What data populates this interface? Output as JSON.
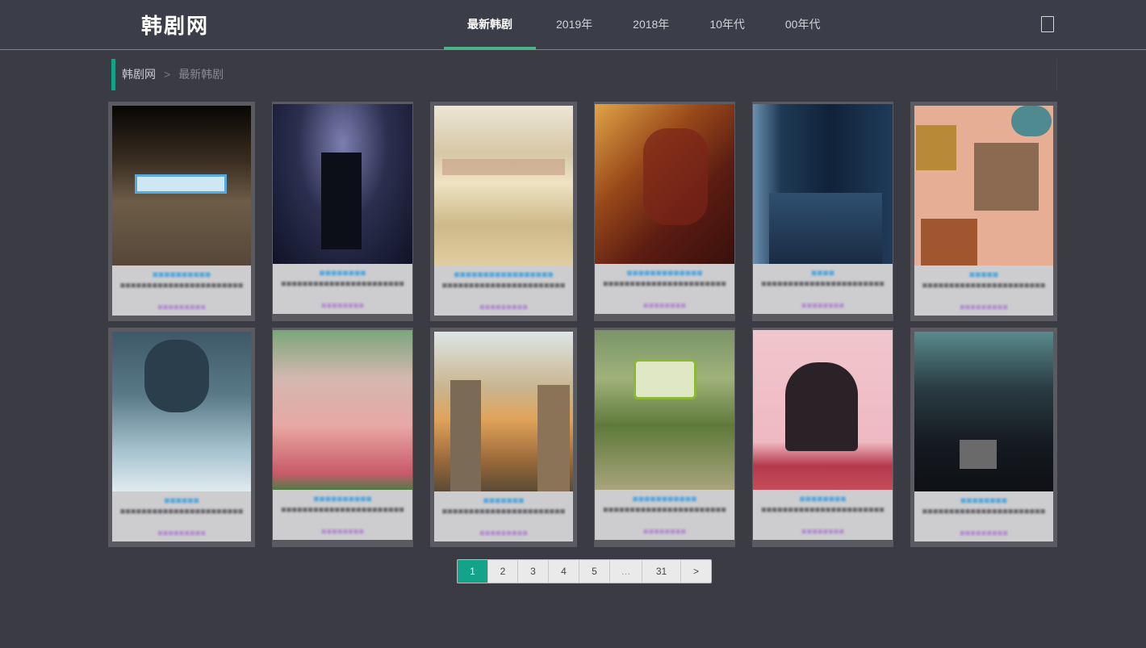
{
  "header": {
    "logo": "韩剧网",
    "nav": [
      {
        "label": "最新韩剧",
        "active": true
      },
      {
        "label": "2019年",
        "active": false
      },
      {
        "label": "2018年",
        "active": false
      },
      {
        "label": "10年代",
        "active": false
      },
      {
        "label": "00年代",
        "active": false
      }
    ],
    "icon": "bookmark-icon"
  },
  "breadcrumb": {
    "home": "韩剧网",
    "separator": ">",
    "current": "最新韩剧"
  },
  "colors": {
    "accent": "#13a38a",
    "nav_underline": "#4db384",
    "title_link": "#57a8de",
    "meta": "#b58fd0"
  },
  "cards": [
    {
      "title": "",
      "desc": "",
      "meta": ""
    },
    {
      "title": "",
      "desc": "",
      "meta": ""
    },
    {
      "title": "",
      "desc": "",
      "meta": ""
    },
    {
      "title": "",
      "desc": "",
      "meta": ""
    },
    {
      "title": "",
      "desc": "",
      "meta": ""
    },
    {
      "title": "",
      "desc": "",
      "meta": ""
    },
    {
      "title": "",
      "desc": "",
      "meta": ""
    },
    {
      "title": "",
      "desc": "",
      "meta": ""
    },
    {
      "title": "",
      "desc": "",
      "meta": ""
    },
    {
      "title": "",
      "desc": "",
      "meta": ""
    },
    {
      "title": "",
      "desc": "",
      "meta": ""
    },
    {
      "title": "",
      "desc": "",
      "meta": ""
    }
  ],
  "pagination": {
    "pages": [
      "1",
      "2",
      "3",
      "4",
      "5",
      "…",
      "31",
      ">"
    ],
    "current": "1"
  }
}
